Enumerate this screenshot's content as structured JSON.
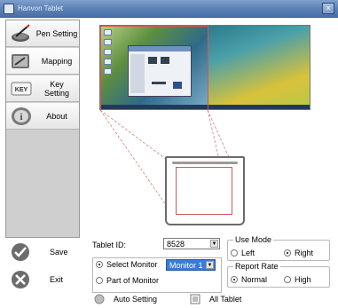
{
  "window": {
    "title": "Hanvon Tablet",
    "close_glyph": "×"
  },
  "sidebar": {
    "items": [
      {
        "label": "Pen Setting",
        "icon": "pen-icon"
      },
      {
        "label": "Mapping",
        "icon": "mapping-icon"
      },
      {
        "label": "Key\nSetting",
        "icon": "keyboard-key-icon",
        "icon_text": "KEY"
      },
      {
        "label": "About",
        "icon": "info-icon",
        "icon_text": "i"
      }
    ]
  },
  "actions": {
    "save": "Save",
    "exit": "Exit"
  },
  "settings": {
    "tablet_id_label": "Tablet ID:",
    "tablet_id_value": "8528",
    "select_monitor_label": "Select Monitor",
    "monitor_value": "Monitor 1",
    "part_of_monitor_label": "Part of Monitor",
    "use_mode": {
      "title": "Use Mode",
      "left": "Left",
      "right": "Right",
      "selected": "Right"
    },
    "report_rate": {
      "title": "Report Rate",
      "normal": "Normal",
      "high": "High",
      "selected": "Normal"
    },
    "monitor_mode_selected": "Select Monitor"
  },
  "footer": {
    "auto_setting": "Auto Setting",
    "all_tablet": "All Tablet"
  },
  "colors": {
    "title_bar": "#5f84b8",
    "sidebar_bg": "#cfcfcf",
    "selection_blue": "#3a7bd8",
    "mapping_red": "#c85a5a"
  }
}
